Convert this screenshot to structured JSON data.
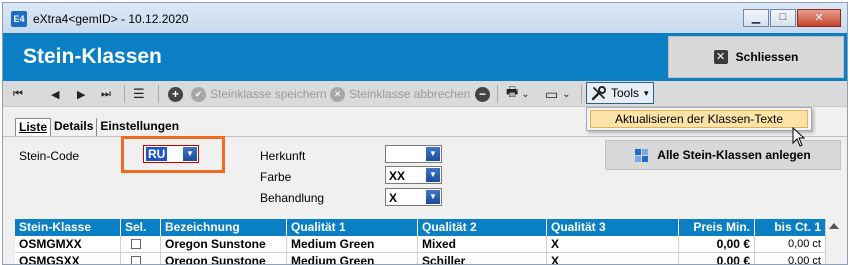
{
  "window": {
    "title": "eXtra4<gemID> - 10.12.2020",
    "app_icon": "E4",
    "minimize_glyph": "▁",
    "maximize_glyph": "□",
    "close_glyph": "✕"
  },
  "header": {
    "title": "Stein-Klassen",
    "close_button": {
      "label": "Schliessen",
      "icon": "close-box-icon"
    }
  },
  "toolbar": {
    "first_glyph": "⏮",
    "prev_glyph": "◀",
    "next_glyph": "▶",
    "last_glyph": "⏭",
    "list_glyph": "☰",
    "add_glyph": "+",
    "save_label": "Steinklasse speichern",
    "save_glyph": "✔",
    "cancel_label": "Steinklasse abbrechen",
    "cancel_glyph": "✕",
    "delete_glyph": "−",
    "print_glyph": "🖶",
    "layout_glyph": "▭",
    "caret": "⌄",
    "tools_label": "Tools",
    "tools_icon": "wrench-screwdriver-icon",
    "tools_caret": "▾"
  },
  "tools_menu": {
    "items": [
      {
        "label": "Aktualisieren der Klassen-Texte"
      }
    ]
  },
  "tabs": [
    {
      "label": "Liste",
      "active": true
    },
    {
      "label": "Details",
      "active": false
    },
    {
      "label": "Einstellungen",
      "active": false
    }
  ],
  "filters": {
    "stein_code": {
      "label": "Stein-Code",
      "value": "RU"
    },
    "herkunft": {
      "label": "Herkunft",
      "value": ""
    },
    "farbe": {
      "label": "Farbe",
      "value": "XX"
    },
    "behandlung": {
      "label": "Behandlung",
      "value": "X"
    },
    "combo_arrow": "▼"
  },
  "all_button": {
    "label": "Alle Stein-Klassen anlegen",
    "icon": "grid-icon"
  },
  "table": {
    "columns": [
      "Stein-Klasse",
      "Sel.",
      "Bezeichnung",
      "Qualität 1",
      "Qualität 2",
      "Qualität 3",
      "Preis Min.",
      "bis Ct. 1"
    ],
    "rows": [
      {
        "klasse": "OSMGMXX",
        "bezeichnung": "Oregon Sunstone",
        "q1": "Medium Green",
        "q2": "Mixed",
        "q3": "X",
        "preis": "0,00 €",
        "bis": "0,00 ct"
      },
      {
        "klasse": "OSMGSXX",
        "bezeichnung": "Oregon Sunstone",
        "q1": "Medium Green",
        "q2": "Schiller",
        "q3": "X",
        "preis": "0,00 €",
        "bis": "0,00 ct"
      }
    ]
  },
  "colors": {
    "header_blue": "#0a7fc3",
    "highlight_orange": "#f26b21",
    "menu_highlight": "#fde3a7"
  }
}
